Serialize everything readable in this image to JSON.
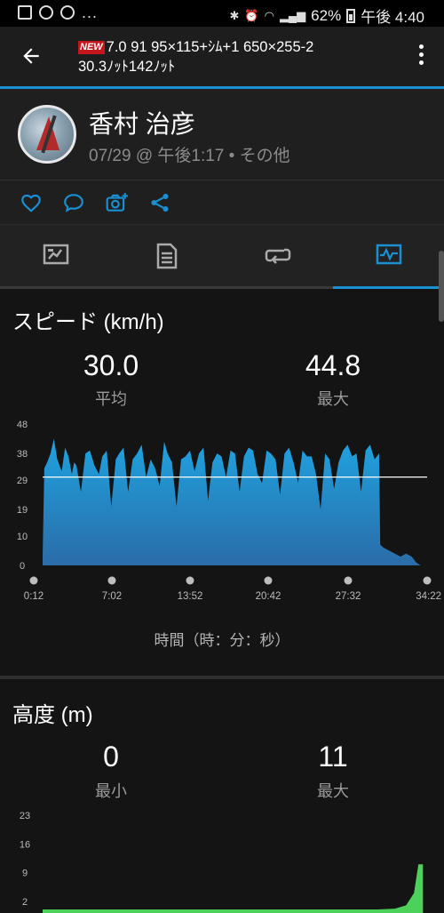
{
  "status_bar": {
    "battery": "62%",
    "time": "午後 4:40"
  },
  "app_bar": {
    "badge": "NEW",
    "title_line1": "7.0 91 95×115+ｼﾑ+1 650×255-2",
    "title_line2": "30.3ﾉｯﾄ142ﾉｯﾄ"
  },
  "profile": {
    "name": "香村 治彦",
    "meta": "07/29 @ 午後1:17 • その他"
  },
  "actions": [
    "like-icon",
    "comment-icon",
    "add-photo-icon",
    "share-icon"
  ],
  "tabs": [
    {
      "icon": "overview-icon",
      "active": false
    },
    {
      "icon": "details-icon",
      "active": false
    },
    {
      "icon": "laps-icon",
      "active": false
    },
    {
      "icon": "charts-icon",
      "active": true
    }
  ],
  "speed": {
    "title": "スピード (km/h)",
    "avg_value": "30.0",
    "avg_label": "平均",
    "max_value": "44.8",
    "max_label": "最大",
    "axis_caption": "時間（時：分：秒）"
  },
  "altitude": {
    "title": "高度 (m)",
    "min_value": "0",
    "min_label": "最小",
    "max_value": "11",
    "max_label": "最大"
  },
  "colors": {
    "accent": "#1a8fd1",
    "speed_fill_top": "#1fa3e0",
    "speed_fill_bottom": "#2a6ca8",
    "altitude_fill": "#4cd25a"
  },
  "chart_data": [
    {
      "type": "area",
      "title": "スピード (km/h)",
      "xlabel": "時間（時：分：秒）",
      "ylabel": "",
      "y_ticks": [
        "0",
        "10",
        "19",
        "29",
        "38",
        "48"
      ],
      "x_ticks": [
        "0:12",
        "7:02",
        "13:52",
        "20:42",
        "27:32",
        "34:22"
      ],
      "ylim": [
        0,
        48
      ],
      "average_line": 30.0,
      "x": [
        0.2,
        0.35,
        0.6,
        0.9,
        1.2,
        1.5,
        1.9,
        2.2,
        2.5,
        2.8,
        3.0,
        3.2,
        3.6,
        4.0,
        4.4,
        4.8,
        5.2,
        5.5,
        5.9,
        6.3,
        6.7,
        7.0,
        7.4,
        7.8,
        8.2,
        8.6,
        9.0,
        9.4,
        9.8,
        10.2,
        10.6,
        11.0,
        11.3,
        11.7,
        12.1,
        12.5,
        12.9,
        13.3,
        13.7,
        14.1,
        14.5,
        14.9,
        15.3,
        15.7,
        16.1,
        16.5,
        16.9,
        17.3,
        17.7,
        18.1,
        18.5,
        18.9,
        19.3,
        19.7,
        20.1,
        20.5,
        20.9,
        21.3,
        21.7,
        22.1,
        22.5,
        22.9,
        23.3,
        23.7,
        24.1,
        24.5,
        24.9,
        25.3,
        25.7,
        26.1,
        26.5,
        26.9,
        27.3,
        27.7,
        28.1,
        28.5,
        28.9,
        29.3,
        29.7,
        30.1,
        30.2,
        30.5,
        31.0,
        31.5,
        32.0,
        32.5,
        33.0,
        33.4,
        33.8
      ],
      "y": [
        3,
        33,
        35,
        38,
        43,
        36,
        32,
        40,
        37,
        31,
        35,
        34,
        25,
        38,
        39,
        34,
        31,
        37,
        39,
        20,
        36,
        38,
        40,
        25,
        36,
        38,
        41,
        30,
        36,
        33,
        27,
        42,
        38,
        35,
        20,
        36,
        37,
        39,
        32,
        38,
        40,
        22,
        35,
        38,
        37,
        30,
        39,
        38,
        25,
        37,
        40,
        39,
        31,
        28,
        39,
        38,
        36,
        24,
        38,
        40,
        35,
        28,
        39,
        37,
        37,
        31,
        19,
        38,
        36,
        26,
        35,
        39,
        41,
        37,
        38,
        25,
        39,
        41,
        36,
        38,
        7,
        6,
        5,
        4,
        3,
        4,
        3,
        1,
        0
      ]
    },
    {
      "type": "area",
      "title": "高度 (m)",
      "y_ticks": [
        "2",
        "9",
        "16",
        "23"
      ],
      "ylim": [
        0,
        23
      ],
      "x": [
        0.2,
        5,
        10,
        15,
        20,
        25,
        30,
        31.5,
        32.5,
        33.2,
        33.6,
        34.0
      ],
      "y": [
        0,
        0,
        0,
        0,
        0,
        0,
        0,
        0.2,
        1,
        4,
        11,
        11
      ]
    }
  ]
}
